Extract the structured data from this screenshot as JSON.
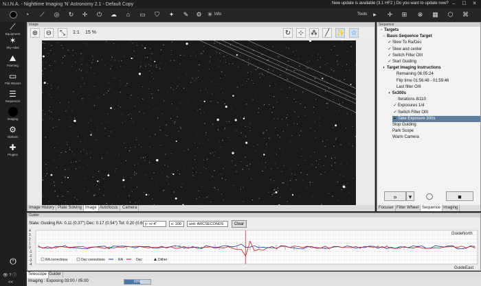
{
  "window": {
    "title": "N.I.N.A. - Nighttime Imaging 'N' Astronomy 2.1   -   Default Copy",
    "update_notice": "New update is available (3.1 HF2 ) Do you want to update now?"
  },
  "toolbar": {
    "info_label": "Info",
    "tools_label": "Tools"
  },
  "nav": {
    "items": [
      {
        "label": "Equipment",
        "icon": "telescope-icon"
      },
      {
        "label": "Sky Atlas",
        "icon": "atlas-icon"
      },
      {
        "label": "Framing",
        "icon": "framing-icon"
      },
      {
        "label": "Flat Wizard",
        "icon": "flat-wizard-icon"
      },
      {
        "label": "Sequencer",
        "icon": "sequencer-icon"
      },
      {
        "label": "Imaging",
        "icon": "imaging-icon"
      },
      {
        "label": "Options",
        "icon": "options-icon"
      },
      {
        "label": "Plugins",
        "icon": "plugins-icon"
      }
    ],
    "collapse_label": "<<"
  },
  "image_panel": {
    "header": "Image",
    "one_to_one": "1:1",
    "zoom": "15 %",
    "tabs": [
      "Image History",
      "Plate Solving",
      "Image",
      "Autofocus",
      "Camera"
    ],
    "active_tab": "Image"
  },
  "sequence_panel": {
    "header": "Sequence",
    "rows": [
      {
        "mark": "−",
        "text": "Targets",
        "bold": true
      },
      {
        "mark": "−",
        "text": "Basic Sequence Target",
        "bold": true
      },
      {
        "mark": "✓",
        "text": "Slew To Ra/Dec",
        "bold": false
      },
      {
        "mark": "✓",
        "text": "Slew and center",
        "bold": false
      },
      {
        "mark": "✓",
        "text": "Switch Filter OIII",
        "bold": false
      },
      {
        "mark": "✓",
        "text": "Start Guiding",
        "bold": false
      },
      {
        "mark": "◐",
        "text": "Target Imaging Instructions",
        "bold": true
      },
      {
        "mark": "",
        "text": "Remaining 06:05:24",
        "bold": false
      },
      {
        "mark": "",
        "text": "Flip time 01:56:46 - 01:59:46",
        "bold": false
      },
      {
        "mark": "",
        "text": "Last filter OIII",
        "bold": false
      },
      {
        "mark": "◐",
        "text": "5x300s",
        "bold": true
      },
      {
        "mark": "",
        "text": "Iterations 8/110",
        "bold": false
      },
      {
        "mark": "✓",
        "text": "Exposures 1/4",
        "bold": false
      },
      {
        "mark": "✓",
        "text": "Switch Filter OIII",
        "bold": false
      },
      {
        "mark": "▸",
        "text": "Take Exposure 300s",
        "bold": false
      },
      {
        "mark": "",
        "text": "Stop Guiding",
        "bold": false
      },
      {
        "mark": "",
        "text": "Park Scope",
        "bold": false
      },
      {
        "mark": "",
        "text": "Warm Camera",
        "bold": false
      }
    ],
    "tabs": [
      "Focuser",
      "Filter Wheel",
      "Sequence",
      "Imaging"
    ],
    "active_tab": "Sequence"
  },
  "guider_panel": {
    "header": "Guider",
    "state": "State: Guiding  RA: 0.11 (0.37\")  Dec: 0.17 (0.54\")  Tot: 0.20 (0.65\")",
    "y_select": "y: +/-4\"",
    "x_select": "x: 100",
    "unit_select": "unit: ARCSECONDS",
    "clear_label": "Clear",
    "guide_north": "GuideNorth",
    "guide_east": "GuideEast",
    "legend": [
      "RA corrections",
      "Dec corrections",
      "RA",
      "Dec",
      "Dither"
    ],
    "ticks": [
      "4",
      "3",
      "2",
      "1",
      "0",
      "-1",
      "-2",
      "-3",
      "-4"
    ],
    "colors": {
      "ra": "#1f2f9e",
      "dec": "#c02020",
      "grid": "#c8c8c8"
    }
  },
  "bottom_tabs": [
    "Telescope",
    "Guider"
  ],
  "active_bottom_tab": "Telescope",
  "status": {
    "text": "Imaging :  Exposing 03:00 / 05:00",
    "progress_label": "60%",
    "progress": 0.6
  }
}
